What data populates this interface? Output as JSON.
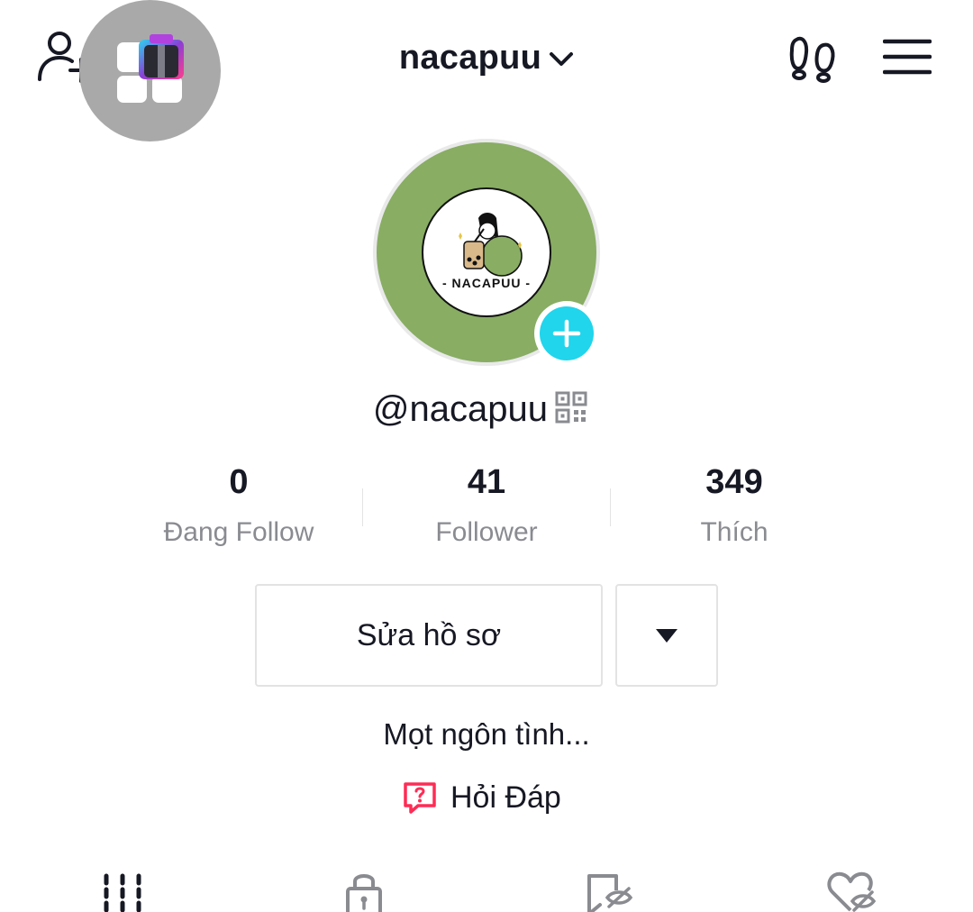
{
  "header": {
    "username_title": "nacapuu",
    "icons": [
      "add-friend-icon",
      "gift-icon",
      "chevron-down-icon",
      "footprint-icon",
      "menu-icon"
    ]
  },
  "profile": {
    "avatar_brand_text": "- NACAPUU -",
    "handle": "@nacapuu",
    "avatar_color": "#88ad63",
    "badge_color": "#20d5ec"
  },
  "stats": [
    {
      "value": "0",
      "label": "Đang Follow"
    },
    {
      "value": "41",
      "label": "Follower"
    },
    {
      "value": "349",
      "label": "Thích"
    }
  ],
  "actions": {
    "edit_profile_label": "Sửa hồ sơ"
  },
  "bio": "Mọt ngôn tình...",
  "qa": {
    "label": "Hỏi Đáp",
    "icon_color": "#fe2c55"
  },
  "tabs": [
    {
      "icon": "videos-grid-icon"
    },
    {
      "icon": "lock-icon"
    },
    {
      "icon": "bookmark-hidden-icon"
    },
    {
      "icon": "heart-hidden-icon"
    }
  ]
}
